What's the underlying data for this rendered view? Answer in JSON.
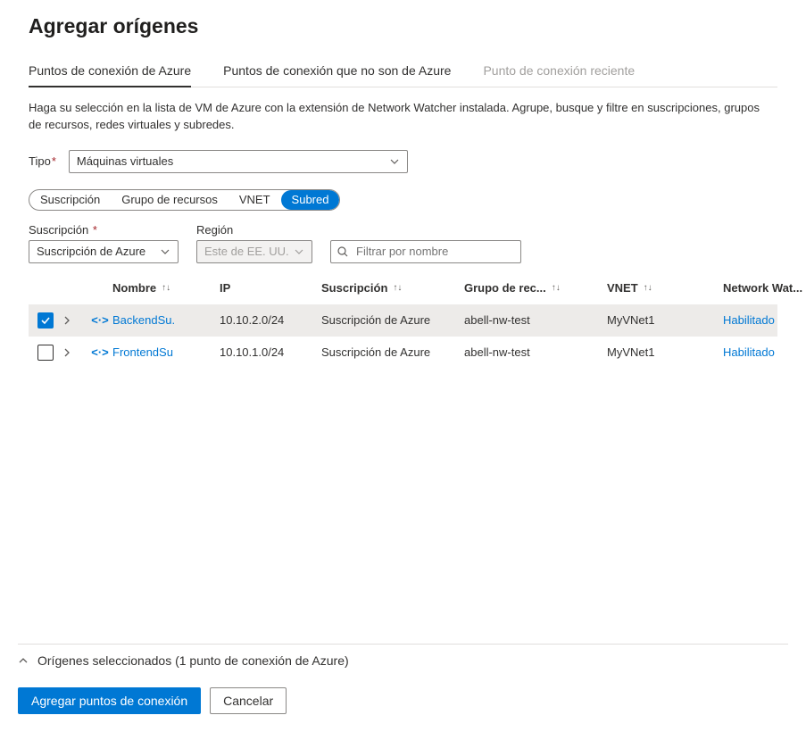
{
  "title": "Agregar orígenes",
  "tabs": {
    "azure": "Puntos de conexión de Azure",
    "nonazure": "Puntos de conexión que no son de Azure",
    "recent": "Punto de conexión reciente"
  },
  "helptext": "Haga su selección en la lista de VM de Azure con la extensión de Network Watcher instalada. Agrupe, busque y filtre en suscripciones, grupos de recursos, redes virtuales y subredes.",
  "type_label": "Tipo",
  "type_value": "Máquinas virtuales",
  "pills": {
    "subscription": "Suscripción",
    "resourcegroup": "Grupo de recursos",
    "vnet": "VNET",
    "subnet": "Subred"
  },
  "filters": {
    "subscription_label": "Suscripción",
    "subscription_value": "Suscripción de Azure",
    "region_label": "Región",
    "region_value": "Este de EE. UU.",
    "search_placeholder": "Filtrar por nombre"
  },
  "columns": {
    "name": "Nombre",
    "ip": "IP",
    "subscription": "Suscripción",
    "rg": "Grupo de rec...",
    "vnet": "VNET",
    "nw": "Network Wat..."
  },
  "rows": [
    {
      "checked": true,
      "name": "BackendSu.",
      "ip": "10.10.2.0/24",
      "subscription": "Suscripción de Azure",
      "rg": "abell-nw-test",
      "vnet": "MyVNet1",
      "nw": "Habilitado"
    },
    {
      "checked": false,
      "name": "FrontendSu",
      "ip": "10.10.1.0/24",
      "subscription": "Suscripción de Azure",
      "rg": "abell-nw-test",
      "vnet": "MyVNet1",
      "nw": "Habilitado"
    }
  ],
  "selected_summary": "Orígenes seleccionados (1 punto de conexión de Azure)",
  "buttons": {
    "add": "Agregar puntos de conexión",
    "cancel": "Cancelar"
  }
}
